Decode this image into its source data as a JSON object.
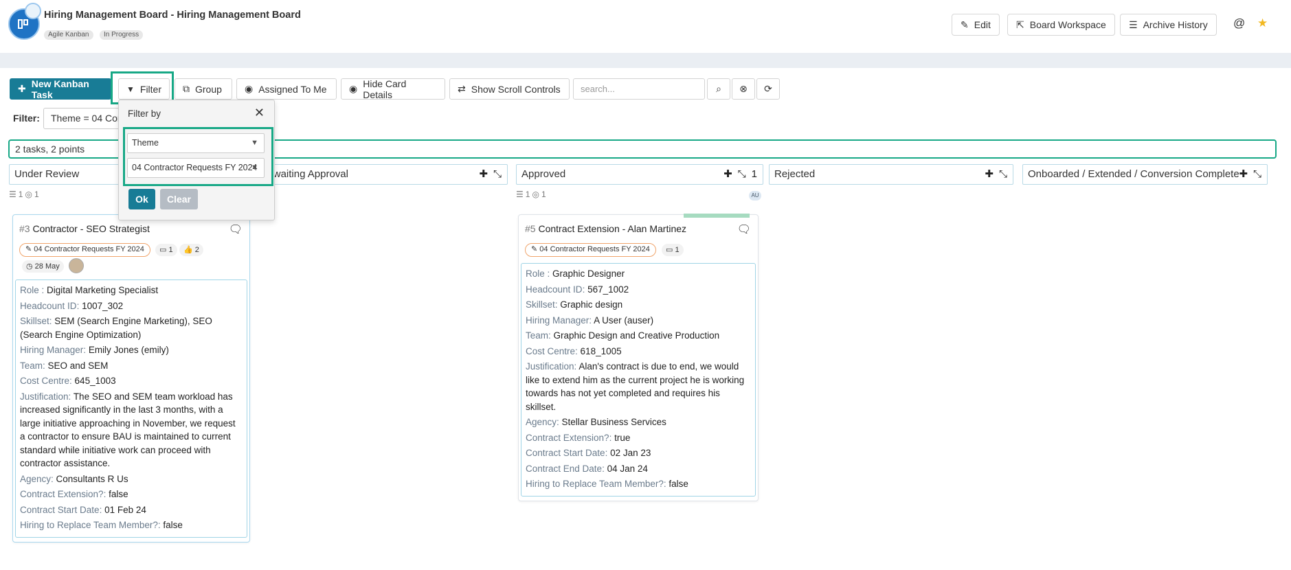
{
  "header": {
    "title": "Hiring Management Board - Hiring Management Board",
    "tags": [
      "Agile Kanban",
      "In Progress"
    ],
    "buttons": {
      "edit": "Edit",
      "workspace": "Board Workspace",
      "archive": "Archive History"
    },
    "icons": {
      "at": "@",
      "star": "★"
    }
  },
  "toolbar": {
    "new_task": "New Kanban Task",
    "filter": "Filter",
    "group": "Group",
    "assigned": "Assigned To Me",
    "hide_details": "Hide Card Details",
    "scroll_controls": "Show Scroll Controls",
    "search_placeholder": "search..."
  },
  "filter_row": {
    "label": "Filter:",
    "chip": "Theme = 04 Contractor Requests FY 2024"
  },
  "summary": "2 tasks, 2 points",
  "columns": [
    {
      "title": "Under Review",
      "meta_count": "1",
      "meta_points": "1"
    },
    {
      "title": "Awaiting Approval",
      "badge": ""
    },
    {
      "title": "Approved",
      "badge": "1",
      "meta_count": "1",
      "meta_points": "1",
      "assignee": "AU"
    },
    {
      "title": "Rejected"
    },
    {
      "title": "Onboarded / Extended / Conversion Complete"
    }
  ],
  "popup": {
    "title": "Filter by",
    "field": "Theme",
    "value": "04 Contractor Requests FY 2024",
    "ok": "Ok",
    "clear": "Clear"
  },
  "cards": [
    {
      "num": "#3",
      "title": "Contractor - SEO Strategist",
      "theme": "04 Contractor Requests FY 2024",
      "tasks": "1",
      "likes": "2",
      "date": "28 May",
      "details": [
        {
          "k": "Role",
          "v": "Digital Marketing Specialist",
          "sep": " : "
        },
        {
          "k": "Headcount ID",
          "v": "1007_302",
          "sep": ": "
        },
        {
          "k": "Skillset",
          "v": "SEM (Search Engine Marketing), SEO (Search Engine Optimization)",
          "sep": ": "
        },
        {
          "k": "Hiring Manager",
          "v": "Emily Jones (emily)",
          "sep": ": "
        },
        {
          "k": "Team",
          "v": "SEO and SEM",
          "sep": ": "
        },
        {
          "k": "Cost Centre",
          "v": "645_1003",
          "sep": ": "
        },
        {
          "k": "Justification",
          "v": "The SEO and SEM team workload has increased significantly in the last 3 months, with a large initiative approaching in November, we request a contractor to ensure BAU is maintained to current standard while initiative work can proceed with contractor assistance.",
          "sep": ": "
        },
        {
          "k": "Agency",
          "v": "Consultants R Us",
          "sep": ": "
        },
        {
          "k": "Contract Extension?",
          "v": "false",
          "sep": ": "
        },
        {
          "k": "Contract Start Date",
          "v": "01 Feb 24",
          "sep": ": "
        },
        {
          "k": "Hiring to Replace Team Member?",
          "v": "false",
          "sep": ": "
        }
      ]
    },
    {
      "num": "#5",
      "title": "Contract Extension - Alan Martinez",
      "theme": "04 Contractor Requests FY 2024",
      "tasks": "1",
      "details": [
        {
          "k": "Role",
          "v": "Graphic Designer",
          "sep": " : "
        },
        {
          "k": "Headcount ID",
          "v": "567_1002",
          "sep": ": "
        },
        {
          "k": "Skillset",
          "v": "Graphic design",
          "sep": ": "
        },
        {
          "k": "Hiring Manager",
          "v": "A User (auser)",
          "sep": ": "
        },
        {
          "k": "Team",
          "v": "Graphic Design and Creative Production",
          "sep": ": "
        },
        {
          "k": "Cost Centre",
          "v": "618_1005",
          "sep": ": "
        },
        {
          "k": "Justification",
          "v": "Alan's contract is due to end, we would like to extend him as the current project he is working towards has not yet completed and requires his skillset.",
          "sep": ": "
        },
        {
          "k": "Agency",
          "v": "Stellar Business Services",
          "sep": ": "
        },
        {
          "k": "Contract Extension?",
          "v": "true",
          "sep": ": "
        },
        {
          "k": "Contract Start Date",
          "v": "02 Jan 23",
          "sep": ": "
        },
        {
          "k": "Contract End Date",
          "v": "04 Jan 24",
          "sep": ": "
        },
        {
          "k": "Hiring to Replace Team Member?",
          "v": "false",
          "sep": ": "
        }
      ]
    }
  ]
}
